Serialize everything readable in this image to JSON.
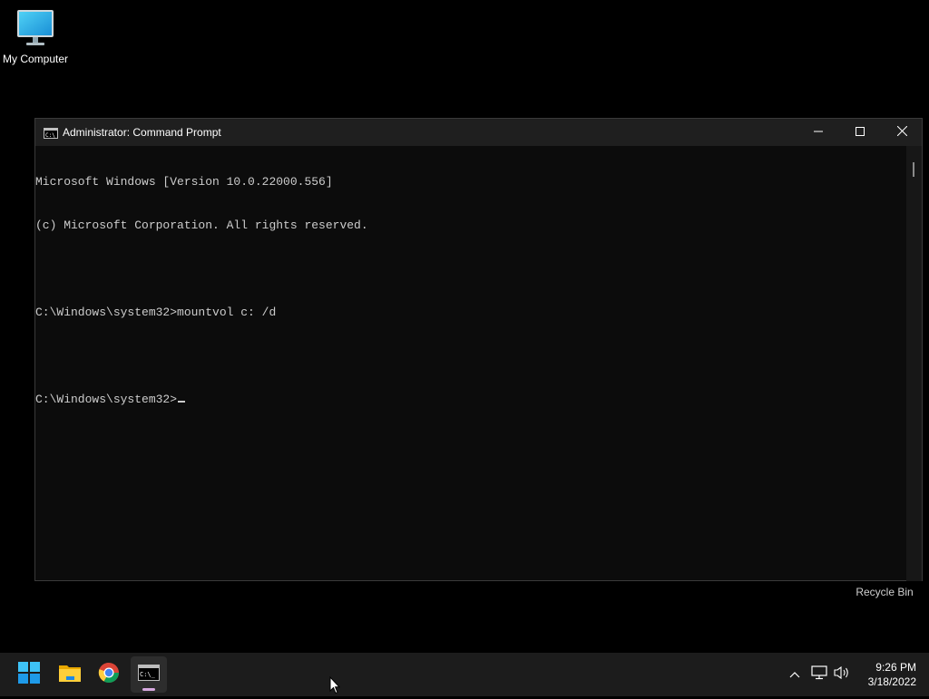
{
  "desktop": {
    "icons": [
      {
        "label": "My Computer"
      },
      {
        "label": "Recycle Bin"
      }
    ]
  },
  "window": {
    "title": "Administrator: Command Prompt",
    "icon": "cmd-icon",
    "controls": [
      "minimize-icon",
      "maximize-icon",
      "close-icon"
    ],
    "lines": [
      "Microsoft Windows [Version 10.0.22000.556]",
      "(c) Microsoft Corporation. All rights reserved.",
      "",
      "C:\\Windows\\system32>mountvol c: /d",
      "",
      "C:\\Windows\\system32>"
    ]
  },
  "taskbar": {
    "apps": [
      "windows-start-icon",
      "file-explorer-icon",
      "chrome-icon",
      "command-prompt-icon"
    ],
    "tray": [
      "chevron-up-icon",
      "network-icon",
      "volume-icon"
    ],
    "clock": {
      "time": "9:26 PM",
      "date": "3/18/2022"
    }
  },
  "colors": {
    "desktop_bg": "#000000",
    "console_bg": "#0c0c0c",
    "console_text": "#cccccc",
    "titlebar_bg": "#1f1f1f",
    "taskbar_bg": "#1c1c1c",
    "active_indicator": "#d7a9e0"
  }
}
